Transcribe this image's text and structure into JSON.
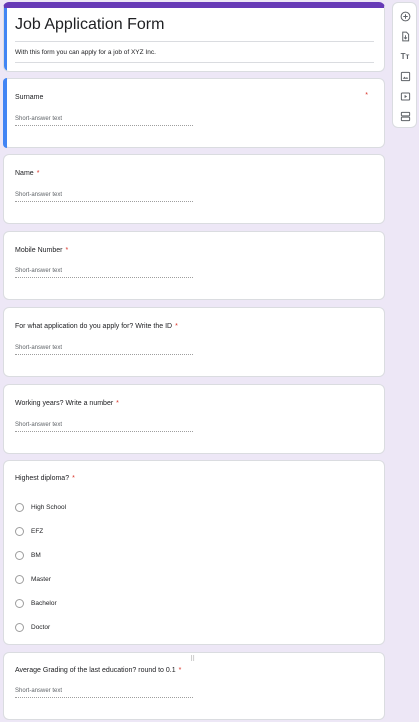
{
  "form": {
    "title": "Job Application Form",
    "description": "With this form you can apply for a job of XYZ Inc."
  },
  "questions": [
    {
      "label": "Surname",
      "required_marker": "*",
      "answer_placeholder": "Short-answer text"
    },
    {
      "label": "Name",
      "required_marker": "*",
      "answer_placeholder": "Short-answer text"
    },
    {
      "label": "Mobile Number",
      "required_marker": "*",
      "answer_placeholder": "Short-answer text"
    },
    {
      "label": "For what application do you apply for? Write the ID",
      "required_marker": "*",
      "answer_placeholder": "Short-answer text"
    },
    {
      "label": "Working years? Write a number",
      "required_marker": "*",
      "answer_placeholder": "Short-answer text"
    },
    {
      "label": "Highest diploma?",
      "required_marker": "*",
      "options": [
        "High School",
        "EFZ",
        "BM",
        "Master",
        "Bachelor",
        "Doctor"
      ]
    },
    {
      "label": "Average Grading of the last education? round to 0.1",
      "required_marker": "*",
      "answer_placeholder": "Short-answer text",
      "drag_handle": "⠿"
    }
  ],
  "toolbar": {
    "items": [
      {
        "icon": "add-question-icon"
      },
      {
        "icon": "import-questions-icon"
      },
      {
        "icon": "add-title-icon",
        "label": "Tт"
      },
      {
        "icon": "add-image-icon"
      },
      {
        "icon": "add-video-icon"
      },
      {
        "icon": "add-section-icon"
      }
    ]
  },
  "colors": {
    "background": "#ede7f6",
    "accent": "#673ab7",
    "active_bar": "#4285f4",
    "required": "#d93025"
  }
}
